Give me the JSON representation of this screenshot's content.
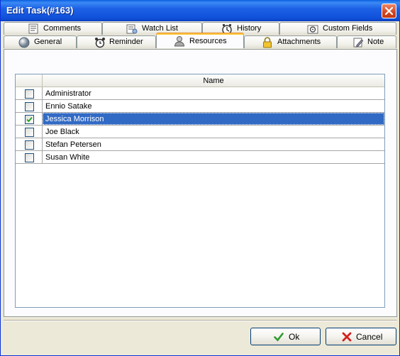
{
  "window": {
    "title": "Edit Task(#163)"
  },
  "tabs_top": [
    {
      "label": "Comments",
      "icon": "comments-icon"
    },
    {
      "label": "Watch List",
      "icon": "watch-list-icon"
    },
    {
      "label": "History",
      "icon": "history-icon"
    },
    {
      "label": "Custom Fields",
      "icon": "custom-fields-icon"
    }
  ],
  "tabs_bottom": [
    {
      "label": "General",
      "icon": "general-icon"
    },
    {
      "label": "Reminder",
      "icon": "alarm-clock-icon"
    },
    {
      "label": "Resources",
      "icon": "resources-icon",
      "active": true
    },
    {
      "label": "Attachments",
      "icon": "padlock-icon"
    },
    {
      "label": "Note",
      "icon": "note-icon"
    }
  ],
  "grid": {
    "column_header": "Name",
    "rows": [
      {
        "name": "Administrator",
        "checked": false,
        "selected": false
      },
      {
        "name": "Ennio Satake",
        "checked": false,
        "selected": false
      },
      {
        "name": "Jessica Morrison",
        "checked": true,
        "selected": true
      },
      {
        "name": "Joe Black",
        "checked": false,
        "selected": false
      },
      {
        "name": "Stefan Petersen",
        "checked": false,
        "selected": false
      },
      {
        "name": "Susan White",
        "checked": false,
        "selected": false
      }
    ]
  },
  "buttons": {
    "ok_label": "Ok",
    "cancel_label": "Cancel"
  },
  "colors": {
    "title_bar": "#0a5fe0",
    "selection": "#316ac5",
    "active_tab_accent": "#ffc83c"
  }
}
